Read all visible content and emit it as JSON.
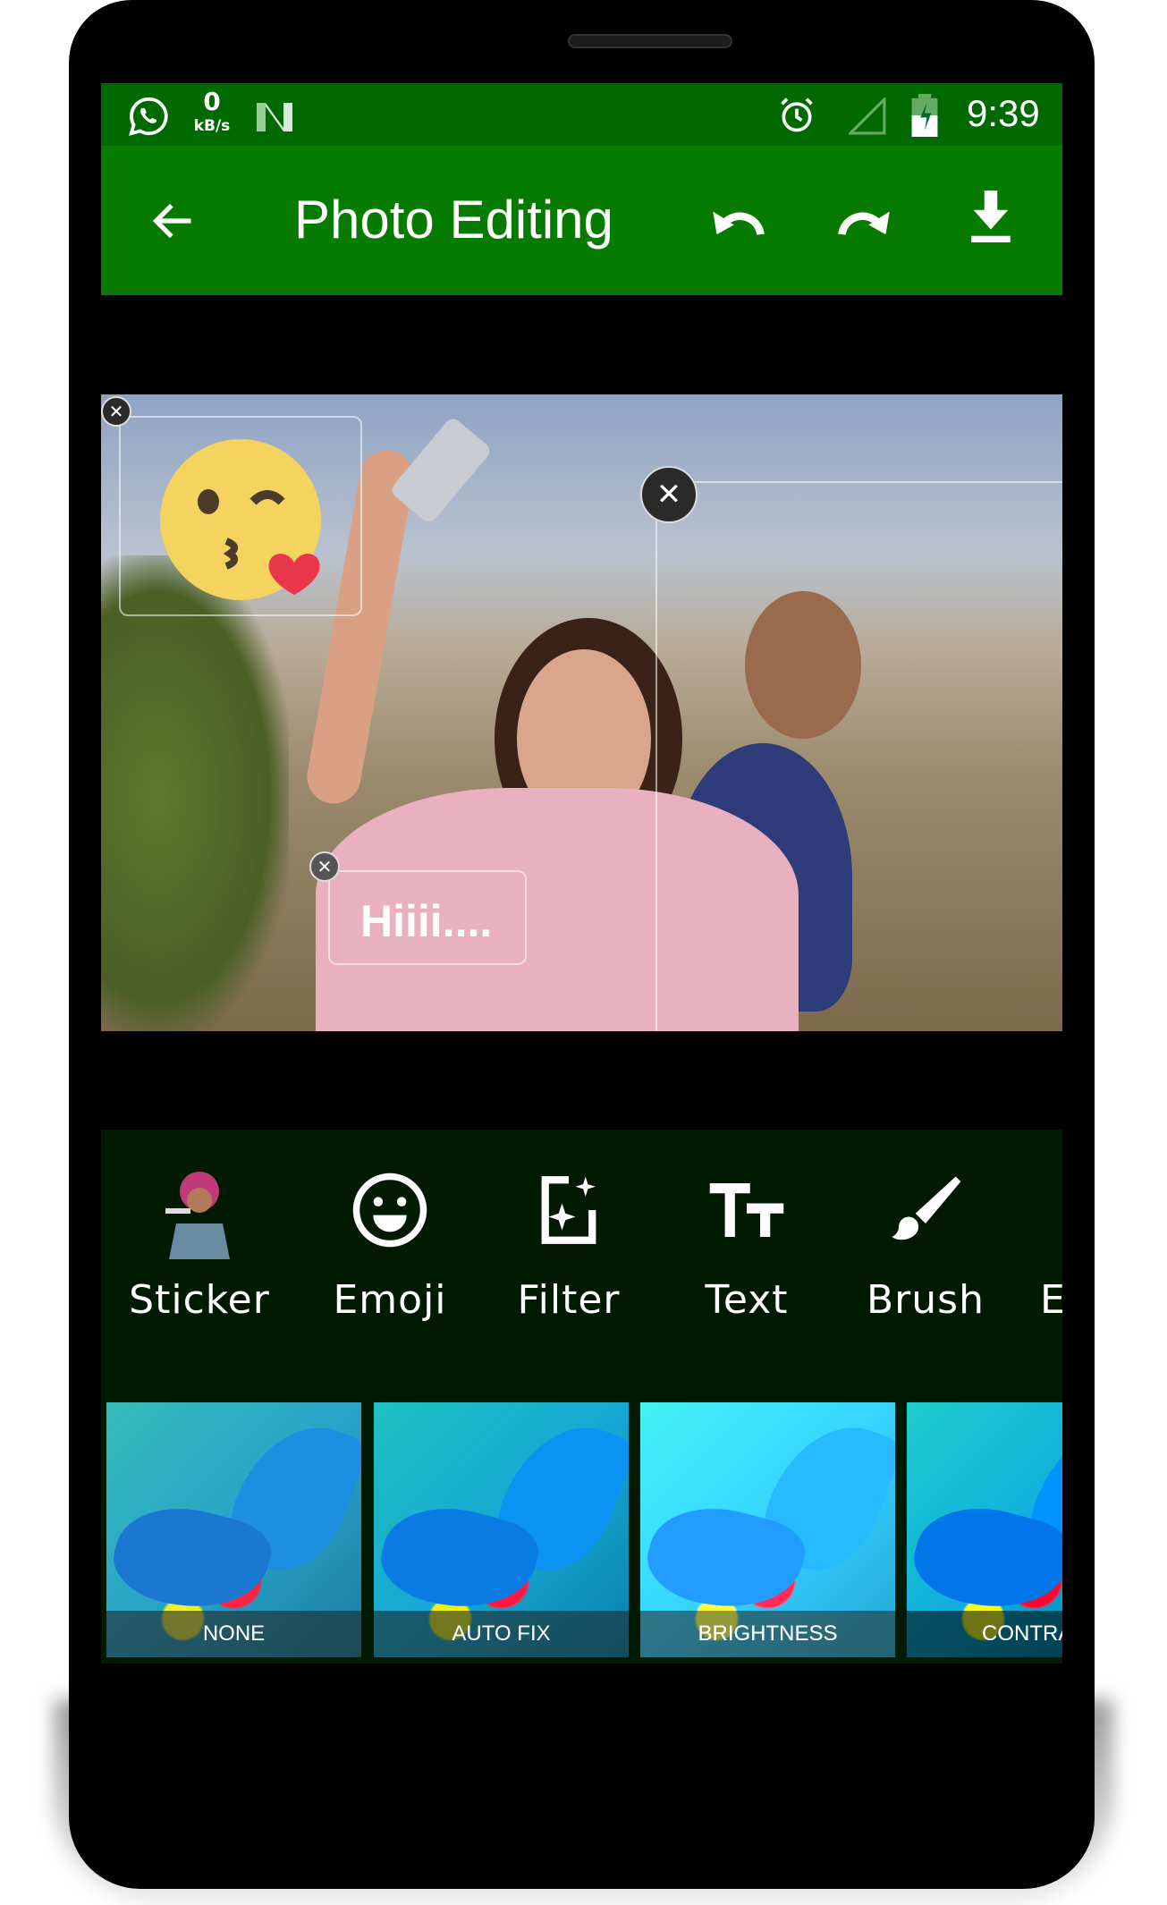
{
  "status_bar": {
    "net_speed_value": "0",
    "net_speed_unit": "kB/s",
    "time": "9:39",
    "icons": [
      "whatsapp-icon",
      "n-icon",
      "alarm-icon",
      "signal-icon",
      "battery-charging-icon"
    ]
  },
  "app_bar": {
    "title": "Photo Editing",
    "icons": [
      "back-arrow-icon",
      "undo-icon",
      "redo-icon",
      "download-icon"
    ]
  },
  "canvas": {
    "text_overlay": "Hiiii....",
    "emoji_sticker": "kissing-face-icon"
  },
  "tools": [
    {
      "label": "Sticker"
    },
    {
      "label": "Emoji"
    },
    {
      "label": "Filter"
    },
    {
      "label": "Text"
    },
    {
      "label": "Brush"
    },
    {
      "label": "E"
    }
  ],
  "filters": [
    {
      "label": "NONE"
    },
    {
      "label": "AUTO FIX"
    },
    {
      "label": "BRIGHTNESS"
    },
    {
      "label": "CONTRA"
    }
  ],
  "colors": {
    "status_bar": "#006a00",
    "app_bar": "#077a00",
    "tools_panel": "#021a02"
  }
}
